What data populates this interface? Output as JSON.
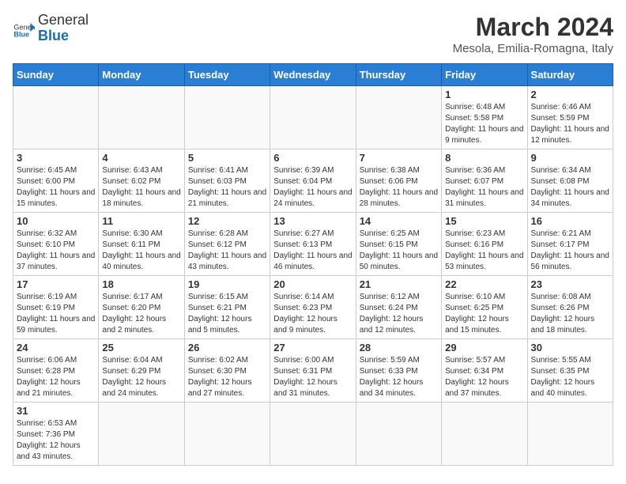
{
  "header": {
    "logo_general": "General",
    "logo_blue": "Blue",
    "month_year": "March 2024",
    "location": "Mesola, Emilia-Romagna, Italy"
  },
  "weekdays": [
    "Sunday",
    "Monday",
    "Tuesday",
    "Wednesday",
    "Thursday",
    "Friday",
    "Saturday"
  ],
  "weeks": [
    [
      {
        "day": "",
        "info": ""
      },
      {
        "day": "",
        "info": ""
      },
      {
        "day": "",
        "info": ""
      },
      {
        "day": "",
        "info": ""
      },
      {
        "day": "",
        "info": ""
      },
      {
        "day": "1",
        "info": "Sunrise: 6:48 AM\nSunset: 5:58 PM\nDaylight: 11 hours and 9 minutes."
      },
      {
        "day": "2",
        "info": "Sunrise: 6:46 AM\nSunset: 5:59 PM\nDaylight: 11 hours and 12 minutes."
      }
    ],
    [
      {
        "day": "3",
        "info": "Sunrise: 6:45 AM\nSunset: 6:00 PM\nDaylight: 11 hours and 15 minutes."
      },
      {
        "day": "4",
        "info": "Sunrise: 6:43 AM\nSunset: 6:02 PM\nDaylight: 11 hours and 18 minutes."
      },
      {
        "day": "5",
        "info": "Sunrise: 6:41 AM\nSunset: 6:03 PM\nDaylight: 11 hours and 21 minutes."
      },
      {
        "day": "6",
        "info": "Sunrise: 6:39 AM\nSunset: 6:04 PM\nDaylight: 11 hours and 24 minutes."
      },
      {
        "day": "7",
        "info": "Sunrise: 6:38 AM\nSunset: 6:06 PM\nDaylight: 11 hours and 28 minutes."
      },
      {
        "day": "8",
        "info": "Sunrise: 6:36 AM\nSunset: 6:07 PM\nDaylight: 11 hours and 31 minutes."
      },
      {
        "day": "9",
        "info": "Sunrise: 6:34 AM\nSunset: 6:08 PM\nDaylight: 11 hours and 34 minutes."
      }
    ],
    [
      {
        "day": "10",
        "info": "Sunrise: 6:32 AM\nSunset: 6:10 PM\nDaylight: 11 hours and 37 minutes."
      },
      {
        "day": "11",
        "info": "Sunrise: 6:30 AM\nSunset: 6:11 PM\nDaylight: 11 hours and 40 minutes."
      },
      {
        "day": "12",
        "info": "Sunrise: 6:28 AM\nSunset: 6:12 PM\nDaylight: 11 hours and 43 minutes."
      },
      {
        "day": "13",
        "info": "Sunrise: 6:27 AM\nSunset: 6:13 PM\nDaylight: 11 hours and 46 minutes."
      },
      {
        "day": "14",
        "info": "Sunrise: 6:25 AM\nSunset: 6:15 PM\nDaylight: 11 hours and 50 minutes."
      },
      {
        "day": "15",
        "info": "Sunrise: 6:23 AM\nSunset: 6:16 PM\nDaylight: 11 hours and 53 minutes."
      },
      {
        "day": "16",
        "info": "Sunrise: 6:21 AM\nSunset: 6:17 PM\nDaylight: 11 hours and 56 minutes."
      }
    ],
    [
      {
        "day": "17",
        "info": "Sunrise: 6:19 AM\nSunset: 6:19 PM\nDaylight: 11 hours and 59 minutes."
      },
      {
        "day": "18",
        "info": "Sunrise: 6:17 AM\nSunset: 6:20 PM\nDaylight: 12 hours and 2 minutes."
      },
      {
        "day": "19",
        "info": "Sunrise: 6:15 AM\nSunset: 6:21 PM\nDaylight: 12 hours and 5 minutes."
      },
      {
        "day": "20",
        "info": "Sunrise: 6:14 AM\nSunset: 6:23 PM\nDaylight: 12 hours and 9 minutes."
      },
      {
        "day": "21",
        "info": "Sunrise: 6:12 AM\nSunset: 6:24 PM\nDaylight: 12 hours and 12 minutes."
      },
      {
        "day": "22",
        "info": "Sunrise: 6:10 AM\nSunset: 6:25 PM\nDaylight: 12 hours and 15 minutes."
      },
      {
        "day": "23",
        "info": "Sunrise: 6:08 AM\nSunset: 6:26 PM\nDaylight: 12 hours and 18 minutes."
      }
    ],
    [
      {
        "day": "24",
        "info": "Sunrise: 6:06 AM\nSunset: 6:28 PM\nDaylight: 12 hours and 21 minutes."
      },
      {
        "day": "25",
        "info": "Sunrise: 6:04 AM\nSunset: 6:29 PM\nDaylight: 12 hours and 24 minutes."
      },
      {
        "day": "26",
        "info": "Sunrise: 6:02 AM\nSunset: 6:30 PM\nDaylight: 12 hours and 27 minutes."
      },
      {
        "day": "27",
        "info": "Sunrise: 6:00 AM\nSunset: 6:31 PM\nDaylight: 12 hours and 31 minutes."
      },
      {
        "day": "28",
        "info": "Sunrise: 5:59 AM\nSunset: 6:33 PM\nDaylight: 12 hours and 34 minutes."
      },
      {
        "day": "29",
        "info": "Sunrise: 5:57 AM\nSunset: 6:34 PM\nDaylight: 12 hours and 37 minutes."
      },
      {
        "day": "30",
        "info": "Sunrise: 5:55 AM\nSunset: 6:35 PM\nDaylight: 12 hours and 40 minutes."
      }
    ],
    [
      {
        "day": "31",
        "info": "Sunrise: 6:53 AM\nSunset: 7:36 PM\nDaylight: 12 hours and 43 minutes."
      },
      {
        "day": "",
        "info": ""
      },
      {
        "day": "",
        "info": ""
      },
      {
        "day": "",
        "info": ""
      },
      {
        "day": "",
        "info": ""
      },
      {
        "day": "",
        "info": ""
      },
      {
        "day": "",
        "info": ""
      }
    ]
  ]
}
